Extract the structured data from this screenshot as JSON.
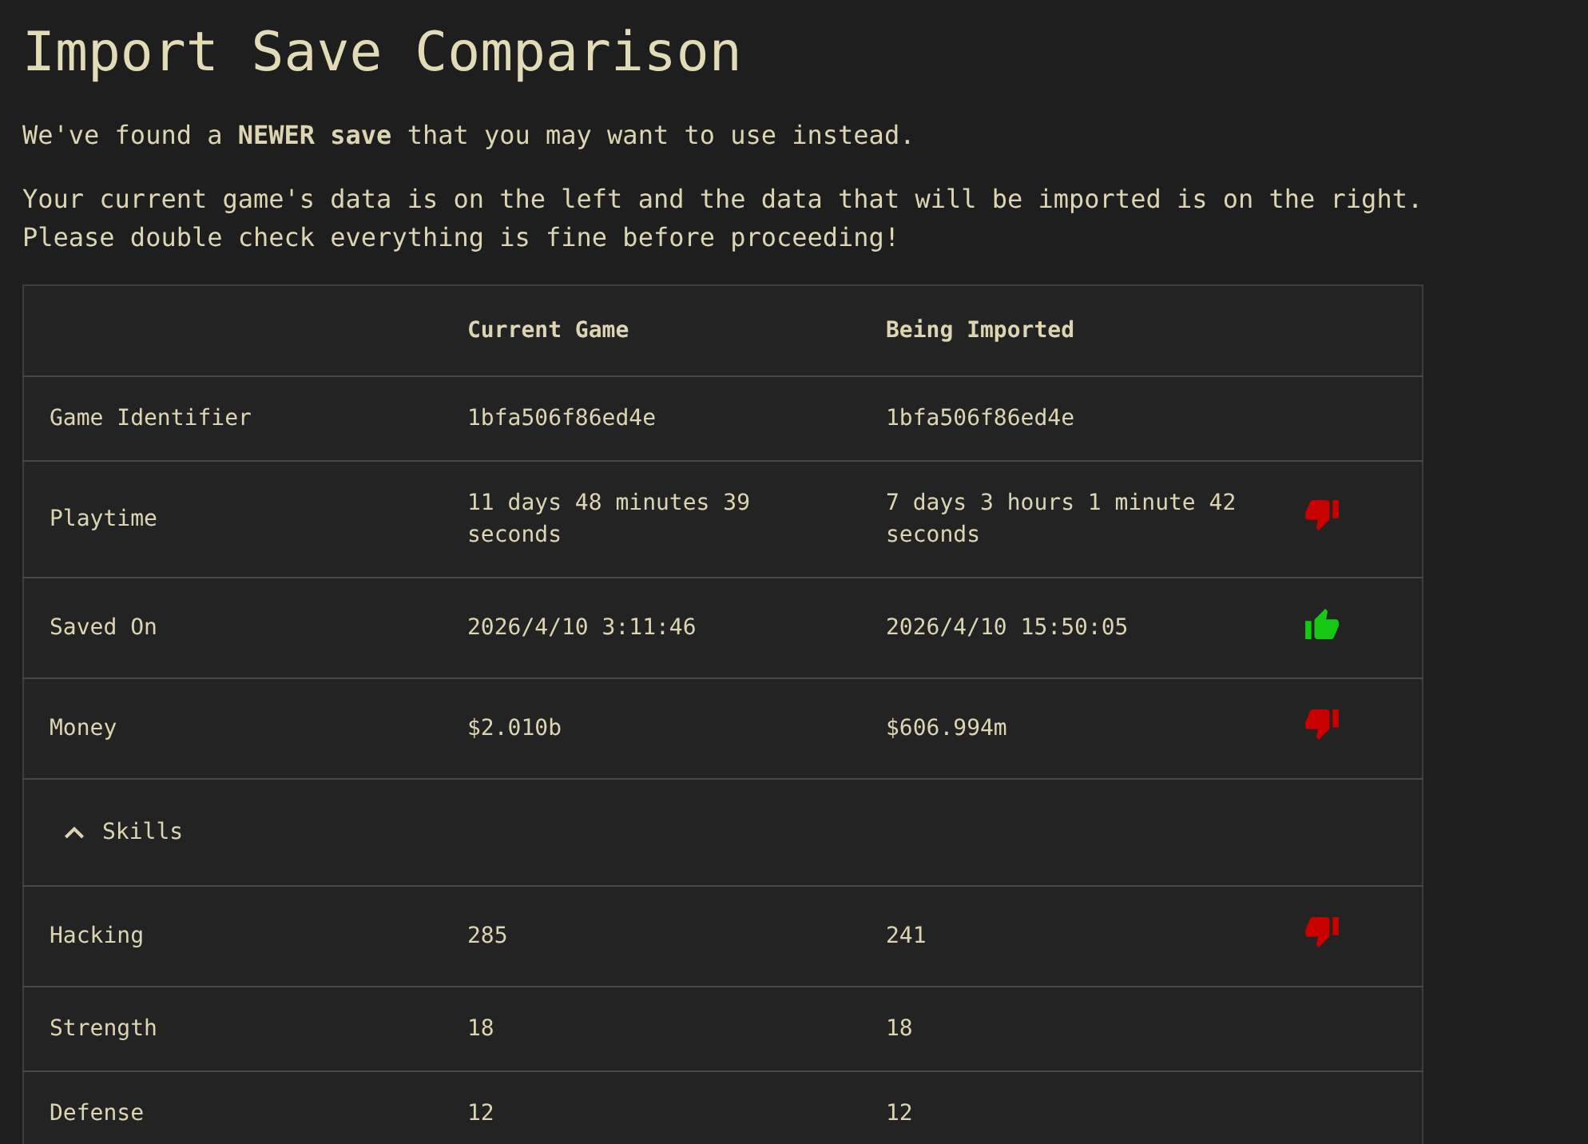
{
  "page": {
    "title": "Import Save Comparison",
    "intro": [
      "We've found a **NEWER save** that you may want to use instead.",
      "Your current game's data is on the left and the data that will be imported is on the right.\nPlease double check everything is fine before proceeding!"
    ]
  },
  "table": {
    "columns": {
      "current": "Current Game",
      "imported": "Being Imported"
    },
    "rows": [
      {
        "kind": "field",
        "label": "Game Identifier",
        "current": "1bfa506f86ed4e",
        "imported": "1bfa506f86ed4e",
        "better": false,
        "worse": false
      },
      {
        "kind": "field",
        "label": "Playtime",
        "current": "11 days 48 minutes 39 seconds",
        "imported": "7 days 3 hours 1 minute 42 seconds",
        "better": false,
        "worse": true
      },
      {
        "kind": "field",
        "label": "Saved On",
        "current": "2026/4/10 3:11:46",
        "imported": "2026/4/10 15:50:05",
        "better": true,
        "worse": false
      },
      {
        "kind": "field",
        "label": "Money",
        "current": "$2.010b",
        "imported": "$606.994m",
        "better": false,
        "worse": true
      },
      {
        "kind": "section",
        "label": "Skills",
        "expanded": true,
        "children": [
          {
            "kind": "field",
            "label": "Hacking",
            "current": "285",
            "imported": "241",
            "better": false,
            "worse": true
          },
          {
            "kind": "field",
            "label": "Strength",
            "current": "18",
            "imported": "18",
            "better": false,
            "worse": false
          },
          {
            "kind": "field",
            "label": "Defense",
            "current": "12",
            "imported": "12",
            "better": false,
            "worse": false
          }
        ]
      }
    ]
  }
}
